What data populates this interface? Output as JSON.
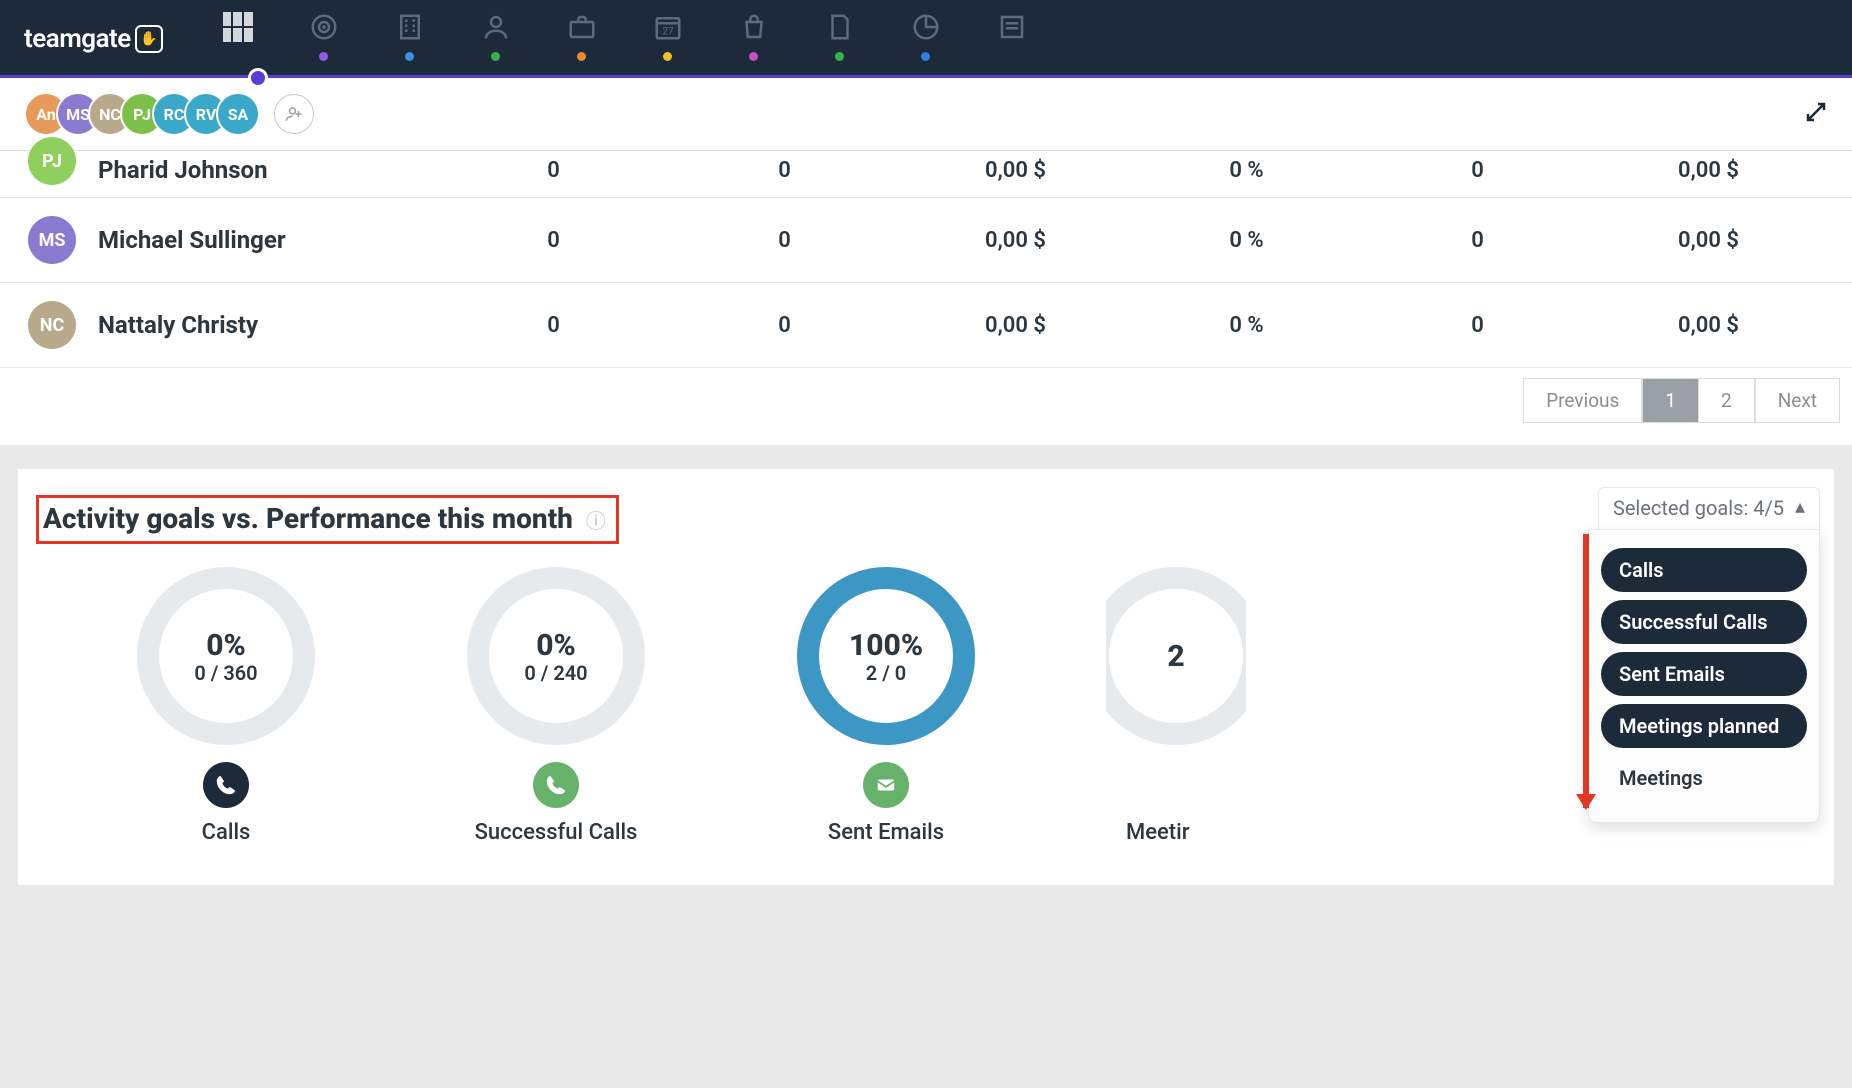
{
  "brand": "teamgate",
  "nav": {
    "dots": [
      "",
      "#8a5fe6",
      "#3a8fe6",
      "#38b24d",
      "#f08a2b",
      "#f3c320",
      "#c94fbf",
      "#38b24d",
      "#2b7fe0",
      ""
    ]
  },
  "avatars": [
    {
      "initials": "An",
      "color": "#e89a5a"
    },
    {
      "initials": "MS",
      "color": "#8a7bd1"
    },
    {
      "initials": "NC",
      "color": "#b7a98a"
    },
    {
      "initials": "PJ",
      "color": "#7cc04a"
    },
    {
      "initials": "RC",
      "color": "#3aa9c9"
    },
    {
      "initials": "RV",
      "color": "#3aa9c9"
    },
    {
      "initials": "SA",
      "color": "#3aa9c9"
    }
  ],
  "table": {
    "rows": [
      {
        "initials": "PJ",
        "color": "#8fcf5e",
        "name": "Pharid Johnson",
        "c1": "0",
        "c2": "0",
        "c3": "0,00 $",
        "c4": "0 %",
        "c5": "0",
        "c6": "0,00 $",
        "cut": true
      },
      {
        "initials": "MS",
        "color": "#8a7bd1",
        "name": "Michael Sullinger",
        "c1": "0",
        "c2": "0",
        "c3": "0,00 $",
        "c4": "0 %",
        "c5": "0",
        "c6": "0,00 $"
      },
      {
        "initials": "NC",
        "color": "#b7a98a",
        "name": "Nattaly Christy",
        "c1": "0",
        "c2": "0",
        "c3": "0,00 $",
        "c4": "0 %",
        "c5": "0",
        "c6": "0,00 $"
      }
    ],
    "pagination": {
      "prev": "Previous",
      "pages": [
        "1",
        "2"
      ],
      "next": "Next",
      "active": "1"
    }
  },
  "goals": {
    "title": "Activity goals vs. Performance this month",
    "selector_label": "Selected goals: 4/5",
    "items": [
      {
        "pct": "0%",
        "sub": "0 / 360",
        "label": "Calls",
        "fill": 0,
        "icon": "phone",
        "icon_style": "navy",
        "ring": "#dfe3e6"
      },
      {
        "pct": "0%",
        "sub": "0 / 240",
        "label": "Successful Calls",
        "fill": 0,
        "icon": "phone",
        "icon_style": "green",
        "ring": "#dfe3e6"
      },
      {
        "pct": "100%",
        "sub": "2 / 0",
        "label": "Sent Emails",
        "fill": 100,
        "icon": "mail",
        "icon_style": "green",
        "ring": "#3d97c4"
      }
    ],
    "partial_label": "Meetir",
    "partial_pct": "2"
  },
  "popover": {
    "options": [
      {
        "label": "Calls",
        "on": true
      },
      {
        "label": "Successful Calls",
        "on": true
      },
      {
        "label": "Sent Emails",
        "on": true
      },
      {
        "label": "Meetings planned",
        "on": true
      },
      {
        "label": "Meetings",
        "on": false
      }
    ]
  },
  "chart_data": {
    "type": "table",
    "title": "Activity goals vs. Performance this month",
    "series": [
      {
        "name": "Calls",
        "value": 0,
        "goal": 360,
        "pct": 0
      },
      {
        "name": "Successful Calls",
        "value": 0,
        "goal": 240,
        "pct": 0
      },
      {
        "name": "Sent Emails",
        "value": 2,
        "goal": 0,
        "pct": 100
      }
    ]
  }
}
